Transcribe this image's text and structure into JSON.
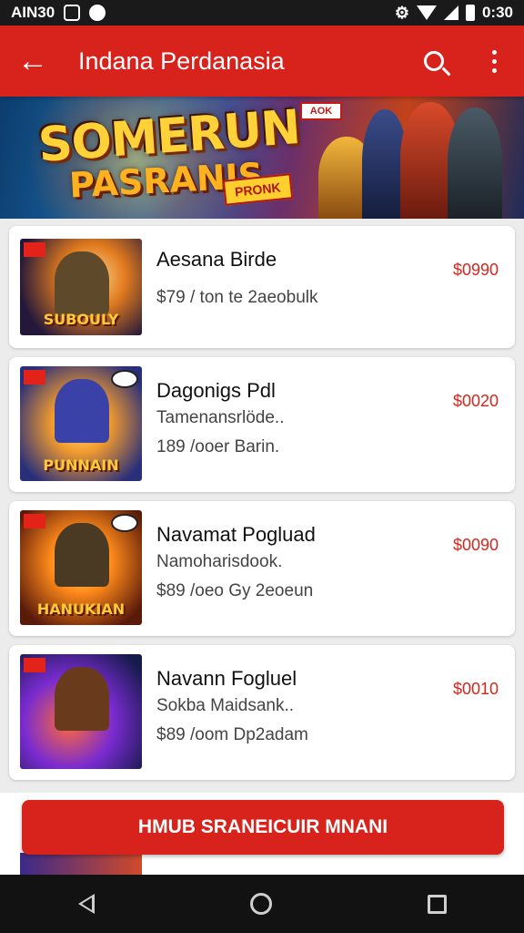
{
  "status_bar": {
    "time_left": "AIN30",
    "time_right": "0:30"
  },
  "app_bar": {
    "title": "Indana Perdanasia"
  },
  "banner": {
    "line1": "SOMERUN",
    "line2": "PASRANIS",
    "tag": "PRONK",
    "badge": "AOK"
  },
  "games": [
    {
      "name": "Aesana Birde",
      "sub1": "",
      "sub2": "$79 / ton te 2aeobulk",
      "price": "$0990",
      "thumb_label": "SUBOULY"
    },
    {
      "name": "Dagonigs Pdl",
      "sub1": "Tamenansrlöde..",
      "sub2": "189 /ooer Barin.",
      "price": "$0020",
      "thumb_label": "PUNNAIN"
    },
    {
      "name": "Navamat Pogluad",
      "sub1": "Namoharisdook.",
      "sub2": "$89 /oeo Gy 2eoeun",
      "price": "$0090",
      "thumb_label": "HANUKIAN"
    },
    {
      "name": "Navann Fogluel",
      "sub1": "Sokba Maidsank..",
      "sub2": "$89 /oom Dp2adam",
      "price": "$0010",
      "thumb_label": ""
    }
  ],
  "cta_label": "HMUB SRANEICUIR MNANI",
  "colors": {
    "primary_red": "#d8221c",
    "price_red": "#d7261e"
  }
}
